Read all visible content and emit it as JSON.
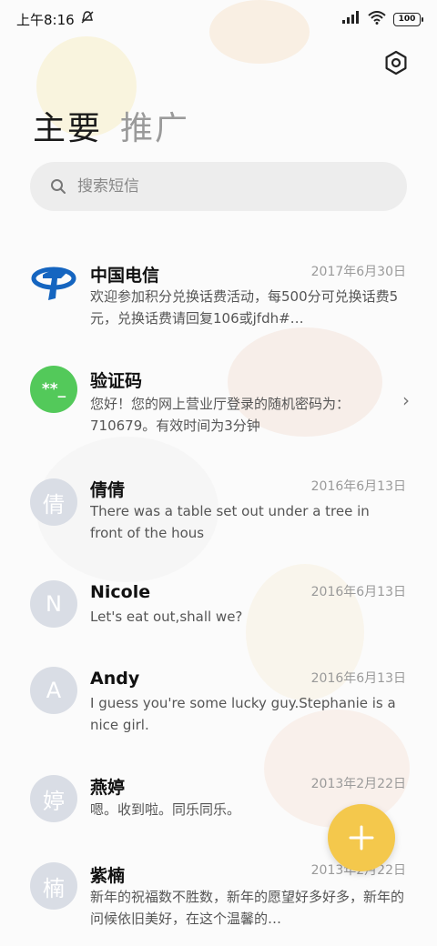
{
  "status_bar": {
    "time": "上午8:16",
    "battery": "100"
  },
  "tabs": [
    {
      "label": "主要"
    },
    {
      "label": "推广"
    }
  ],
  "search": {
    "placeholder": "搜索短信"
  },
  "messages": [
    {
      "name": "中国电信",
      "date": "2017年6月30日",
      "preview": "欢迎参加积分兑换话费活动，每500分可兑换话费5元，兑换话费请回复106或jfdh#…",
      "avatar": "telecom-logo"
    },
    {
      "name": "验证码",
      "date": "",
      "preview": "您好！您的网上营业厅登录的随机密码为：710679。有效时间为3分钟",
      "avatar_text": "**_"
    },
    {
      "name": "倩倩",
      "date": "2016年6月13日",
      "preview": "There was a table set out under a tree in front of the hous",
      "avatar_text": "倩"
    },
    {
      "name": "Nicole",
      "date": "2016年6月13日",
      "preview": "Let's eat out,shall we?",
      "avatar_text": "N"
    },
    {
      "name": "Andy",
      "date": "2016年6月13日",
      "preview": "I guess you're some lucky guy.Stephanie is a nice girl.",
      "avatar_text": "A"
    },
    {
      "name": "燕婷",
      "date": "2013年2月22日",
      "preview": "嗯。收到啦。同乐同乐。",
      "avatar_text": "婷"
    },
    {
      "name": "紫楠",
      "date": "2013年2月22日",
      "preview": "新年的祝福数不胜数，新年的愿望好多好多，新年的问候依旧美好，在这个温馨的…",
      "avatar_text": "楠"
    }
  ],
  "colors": {
    "fab": "#f4c84c",
    "verify_avatar": "#53c95a",
    "telecom_blue": "#1565c0"
  }
}
